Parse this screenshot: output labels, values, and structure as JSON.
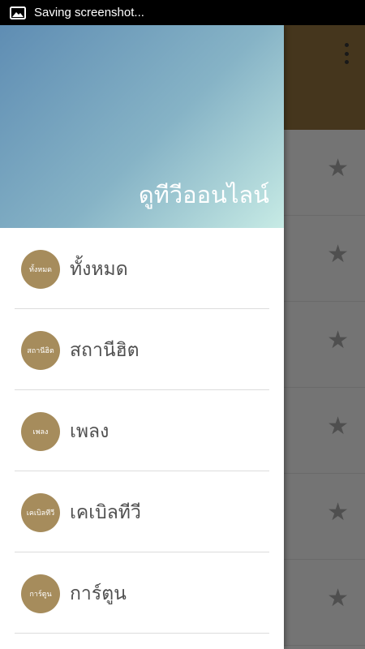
{
  "status_bar": {
    "text": "Saving screenshot..."
  },
  "drawer": {
    "title": "ดูทีวีออนไลน์",
    "items": [
      {
        "badge": "ทั้งหมด",
        "label": "ทั้งหมด"
      },
      {
        "badge": "สถานีฮิต",
        "label": "สถานีฮิต"
      },
      {
        "badge": "เพลง",
        "label": "เพลง"
      },
      {
        "badge": "เคเบิลทีวี",
        "label": "เคเบิลทีวี"
      },
      {
        "badge": "การ์ตูน",
        "label": "การ์ตูน"
      }
    ]
  },
  "colors": {
    "badge": "#a68c5c",
    "toolbar": "#8b6d3a",
    "header_gradient_start": "#5f8db3",
    "header_gradient_end": "#c7ebe5"
  },
  "icons": {
    "status": "image-icon",
    "overflow": "more-vert-icon",
    "favorite": "star-icon"
  }
}
